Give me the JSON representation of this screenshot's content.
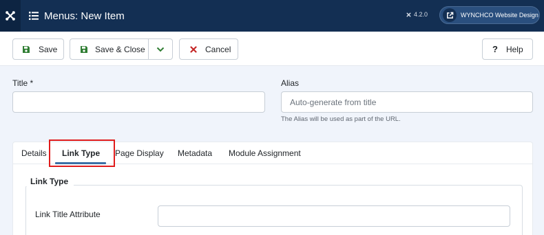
{
  "header": {
    "title": "Menus: New Item",
    "version": "4.2.0",
    "site_button_label": "WYNCHCO Website Design"
  },
  "toolbar": {
    "save_label": "Save",
    "save_close_label": "Save & Close",
    "cancel_label": "Cancel",
    "help_label": "Help"
  },
  "form": {
    "title_label": "Title *",
    "title_value": "",
    "alias_label": "Alias",
    "alias_placeholder": "Auto-generate from title",
    "alias_help": "The Alias will be used as part of the URL."
  },
  "tabs": [
    {
      "label": "Details",
      "active": false
    },
    {
      "label": "Link Type",
      "active": true
    },
    {
      "label": "Page Display",
      "active": false
    },
    {
      "label": "Metadata",
      "active": false
    },
    {
      "label": "Module Assignment",
      "active": false
    }
  ],
  "link_type_section": {
    "legend": "Link Type",
    "link_title_attribute_label": "Link Title Attribute",
    "link_title_attribute_value": ""
  },
  "colors": {
    "header_bg": "#132f53",
    "save_icon": "#2f7d32",
    "cancel_icon": "#c52828",
    "highlight": "#e01b1b",
    "active_tab_underline": "#3b6fa5"
  }
}
